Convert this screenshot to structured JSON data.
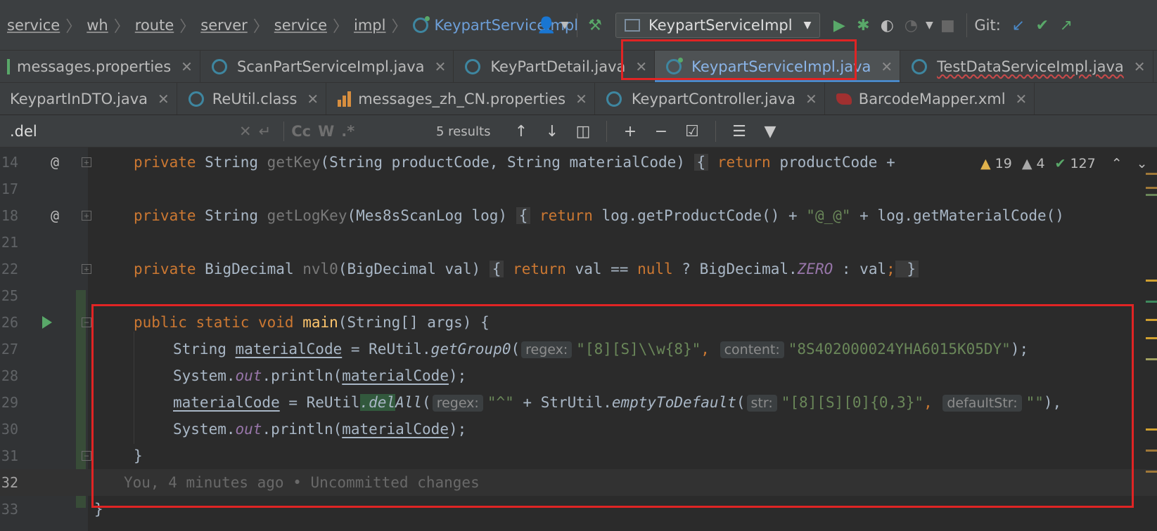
{
  "colors": {
    "accent": "#4a88c7",
    "red_annotation": "#e02424",
    "keyword": "#cc7832",
    "string": "#6a8759",
    "function": "#ffc66d"
  },
  "breadcrumb": [
    "service",
    "wh",
    "route",
    "server",
    "service",
    "impl"
  ],
  "breadcrumb_current": "KeypartServiceImpl",
  "run_config": "KeypartServiceImpl",
  "git_label": "Git:",
  "tabs_row1": [
    {
      "label": "messages.properties",
      "icon": "properties-icon"
    },
    {
      "label": "ScanPartServiceImpl.java",
      "icon": "class-icon"
    },
    {
      "label": "KeyPartDetail.java",
      "icon": "class-icon"
    },
    {
      "label": "KeypartServiceImpl.java",
      "icon": "class-icon",
      "active": true
    },
    {
      "label": "TestDataServiceImpl.java",
      "icon": "class-icon"
    }
  ],
  "tabs_row2": [
    {
      "label": "KeypartInDTO.java",
      "icon": "none"
    },
    {
      "label": "ReUtil.class",
      "icon": "class-icon"
    },
    {
      "label": "messages_zh_CN.properties",
      "icon": "properties-icon"
    },
    {
      "label": "KeypartController.java",
      "icon": "class-icon"
    },
    {
      "label": "BarcodeMapper.xml",
      "icon": "xml-icon"
    }
  ],
  "find": {
    "query": ".del",
    "results": "5 results",
    "opt_case": "Cc",
    "opt_word": "W",
    "opt_regex": ".*"
  },
  "inspections": {
    "warnings": "19",
    "weak_warnings": "4",
    "typos": "127"
  },
  "editor": {
    "line_numbers": [
      "14",
      "17",
      "18",
      "21",
      "22",
      "25",
      "26",
      "27",
      "28",
      "29",
      "30",
      "31",
      "32",
      "33"
    ],
    "l14": {
      "k1": "private ",
      "t": "String ",
      "name": "getKey",
      "rest": "(String productCode, String materialCode) ",
      "b": "{",
      "k2": " return",
      "tail": " productCode +"
    },
    "l18": {
      "k1": "private ",
      "t": "String ",
      "name": "getLogKey",
      "rest": "(Mes8sScanLog log) ",
      "b": "{",
      "k2": " return",
      "tail": " log.getProductCode() + ",
      "s": "\"@_@\"",
      "tail2": " + log.getMaterialCode()"
    },
    "l22": {
      "k1": "private ",
      "t": "BigDecimal ",
      "name": "nvl0",
      "rest": "(BigDecimal val) ",
      "b": "{",
      "k2": " return",
      "tail": " val == ",
      "k3": "null",
      "tail2": " ? BigDecimal.",
      "zero": "ZERO",
      "tail3": " : val",
      "semi": ";",
      "b2": " }"
    },
    "l26": {
      "k1": "public static void ",
      "name": "main",
      "rest": "(String[] args) {"
    },
    "l27": {
      "t": "String ",
      "var": "materialCode",
      "eq": " = ReUtil.",
      "m": "getGroup0",
      "p": "(",
      "h1": "regex:",
      "s1": "\"[8][S]\\\\w{8}\"",
      "c": ", ",
      "h2": "content:",
      "s2": "\"8S402000024YHA6015K05DY\"",
      "end": ");"
    },
    "l28": {
      "a": "System.",
      "out": "out",
      "b": ".println(",
      "var": "materialCode",
      "end": ");"
    },
    "l29": {
      "var": "materialCode",
      "eq": " = ReUtil",
      "m1": ".del",
      "m2": "All",
      "p": "(",
      "h1": "regex:",
      "s1": "\"^\"",
      "plus": " + StrUtil.",
      "m3": "emptyToDefault",
      "p2": "(",
      "h2": "str:",
      "s2": "\"[8][S][0]{0,3}\"",
      "c": ", ",
      "h3": "defaultStr:",
      "s3": "\"\"",
      "end": "),"
    },
    "l30": {
      "a": "System.",
      "out": "out",
      "b": ".println(",
      "var": "materialCode",
      "end": ");"
    },
    "l31": {
      "b": "}"
    },
    "l32": {
      "blame": "You, 4 minutes ago • Uncommitted changes"
    },
    "l33": {
      "b": "}"
    }
  }
}
